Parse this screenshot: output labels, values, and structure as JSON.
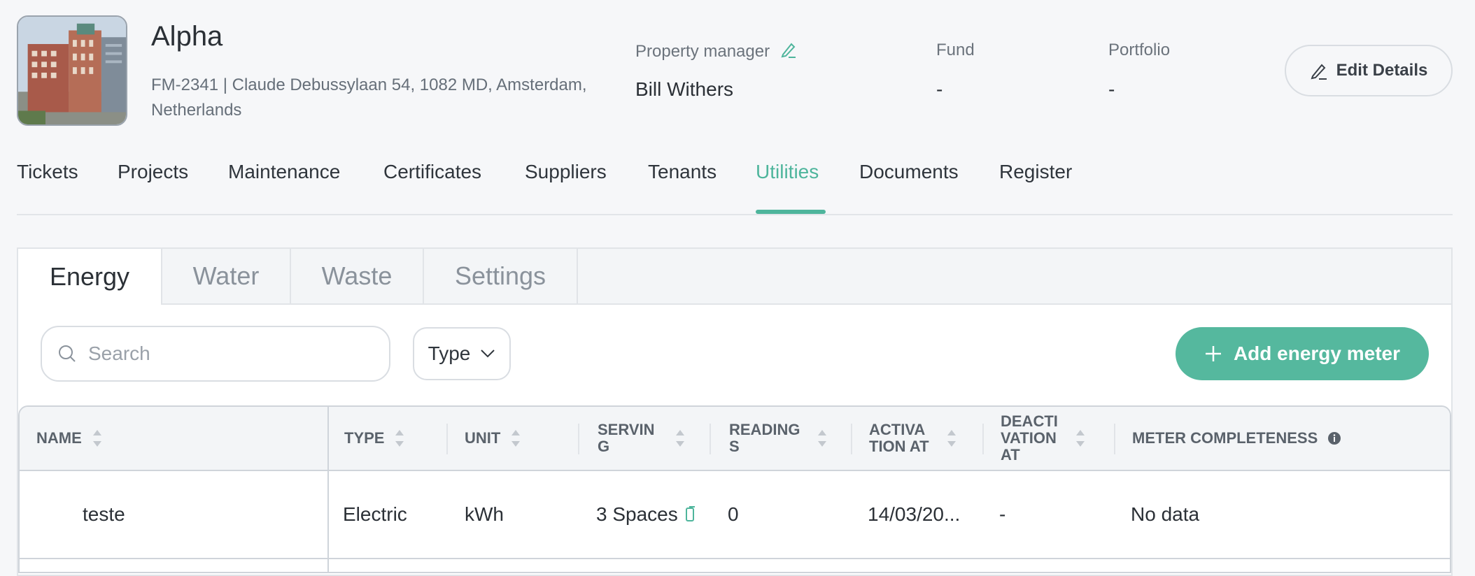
{
  "property": {
    "title": "Alpha",
    "address": "FM-2341 | Claude Debussylaan 54, 1082 MD, Amsterdam, Netherlands",
    "manager_label": "Property manager",
    "manager_value": "Bill Withers",
    "fund_label": "Fund",
    "fund_value": "-",
    "portfolio_label": "Portfolio",
    "portfolio_value": "-",
    "edit_label": "Edit Details"
  },
  "main_tabs": [
    {
      "label": "Tickets"
    },
    {
      "label": "Projects"
    },
    {
      "label": "Maintenance"
    },
    {
      "label": "Certificates"
    },
    {
      "label": "Suppliers"
    },
    {
      "label": "Tenants"
    },
    {
      "label": "Utilities"
    },
    {
      "label": "Documents"
    },
    {
      "label": "Register"
    }
  ],
  "sub_tabs": [
    {
      "label": "Energy"
    },
    {
      "label": "Water"
    },
    {
      "label": "Waste"
    },
    {
      "label": "Settings"
    }
  ],
  "toolbar": {
    "search_placeholder": "Search",
    "type_label": "Type",
    "add_label": "Add energy meter"
  },
  "table": {
    "headers": [
      "NAME",
      "TYPE",
      "UNIT",
      "SERVIN\nG",
      "READING\nS",
      "ACTIVA\nTION AT",
      "DEACTI\nVATION\nAT",
      "METER COMPLETENESS"
    ],
    "rows": [
      [
        "teste",
        "Electric",
        "kWh",
        "3 Spaces",
        "0",
        "14/03/20...",
        "-",
        "No data"
      ]
    ]
  },
  "colors": {
    "accent": "#4eb59c",
    "button": "#55b89e"
  }
}
